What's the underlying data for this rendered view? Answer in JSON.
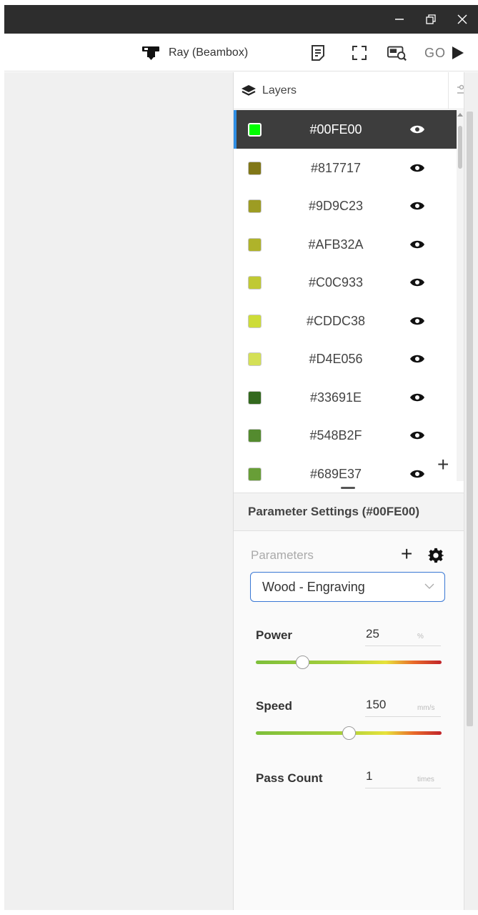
{
  "window": {
    "minimize_glyph": "—",
    "restore_glyph": "⧉",
    "close_glyph": "✕"
  },
  "toolbar": {
    "machine_name": "Ray (Beambox)",
    "machine_icon": "laser-head-icon",
    "icons": [
      "notes-icon",
      "frame-icon",
      "preview-icon"
    ],
    "go_label": "GO"
  },
  "layers": {
    "title": "Layers",
    "items": [
      {
        "name": "#00FE00",
        "color": "#00FE00",
        "selected": true
      },
      {
        "name": "#817717",
        "color": "#817717",
        "selected": false
      },
      {
        "name": "#9D9C23",
        "color": "#9D9C23",
        "selected": false
      },
      {
        "name": "#AFB32A",
        "color": "#AFB32A",
        "selected": false
      },
      {
        "name": "#C0C933",
        "color": "#C0C933",
        "selected": false
      },
      {
        "name": "#CDDC38",
        "color": "#CDDC38",
        "selected": false
      },
      {
        "name": "#D4E056",
        "color": "#D4E056",
        "selected": false
      },
      {
        "name": "#33691E",
        "color": "#33691E",
        "selected": false
      },
      {
        "name": "#548B2F",
        "color": "#548B2F",
        "selected": false
      },
      {
        "name": "#689E37",
        "color": "#689E37",
        "selected": false
      }
    ],
    "add_glyph": "+"
  },
  "parameters": {
    "header": "Parameter Settings (#00FE00)",
    "label": "Parameters",
    "add_glyph": "+",
    "preset": "Wood - Engraving",
    "power": {
      "label": "Power",
      "value": "25",
      "unit": "%",
      "fraction": 0.25
    },
    "speed": {
      "label": "Speed",
      "value": "150",
      "unit": "mm/s",
      "fraction": 0.5
    },
    "pass_count": {
      "label": "Pass Count",
      "value": "1",
      "unit": "times"
    }
  }
}
